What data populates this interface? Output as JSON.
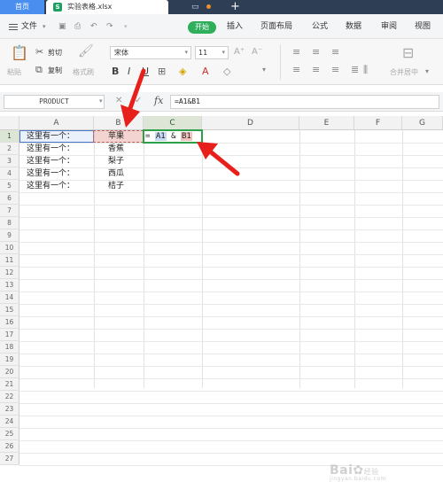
{
  "tabs": {
    "home": "首页",
    "file": "实验表格.xlsx",
    "file_icon": "S",
    "plus": "+"
  },
  "menu": {
    "items": [
      "文件",
      "开始",
      "插入",
      "页面布局",
      "公式",
      "数据",
      "审阅",
      "视图"
    ]
  },
  "ribbon": {
    "cut": "剪切",
    "copy": "复制",
    "paste": "粘贴",
    "format_painter": "格式刷",
    "font": "宋体",
    "font_size": "11",
    "merge_center": "合并居中"
  },
  "formula_bar": {
    "name_box": "PRODUCT",
    "fx": "fx",
    "formula": "=A1&B1"
  },
  "grid": {
    "columns": [
      "A",
      "B",
      "C",
      "D",
      "E",
      "F",
      "G"
    ],
    "rows": [
      "1",
      "2",
      "3",
      "4",
      "5",
      "6",
      "7",
      "8",
      "9",
      "10",
      "11",
      "12",
      "13",
      "14",
      "15",
      "16",
      "17",
      "18",
      "19",
      "20",
      "21",
      "22",
      "23",
      "24",
      "25",
      "26",
      "27"
    ],
    "col_a": [
      "这里有一个：",
      "这里有一个：",
      "这里有一个：",
      "这里有一个：",
      "这里有一个："
    ],
    "col_b": [
      "苹果",
      "香蕉",
      "梨子",
      "西瓜",
      "桔子"
    ],
    "c1_eq": "=",
    "c1_ref_a": "A1",
    "c1_amp": "&",
    "c1_ref_b": "B1"
  },
  "watermark": {
    "text": "Bai",
    "sub": "经验",
    "domain": "jingyan.baidu.com"
  },
  "colors": {
    "tab_bar": "#2d3e55",
    "home_tab": "#4a8ff0",
    "start_button": "#2fae5c",
    "active_cell_border": "#2fa04a",
    "arrow_red": "#e8201c"
  }
}
